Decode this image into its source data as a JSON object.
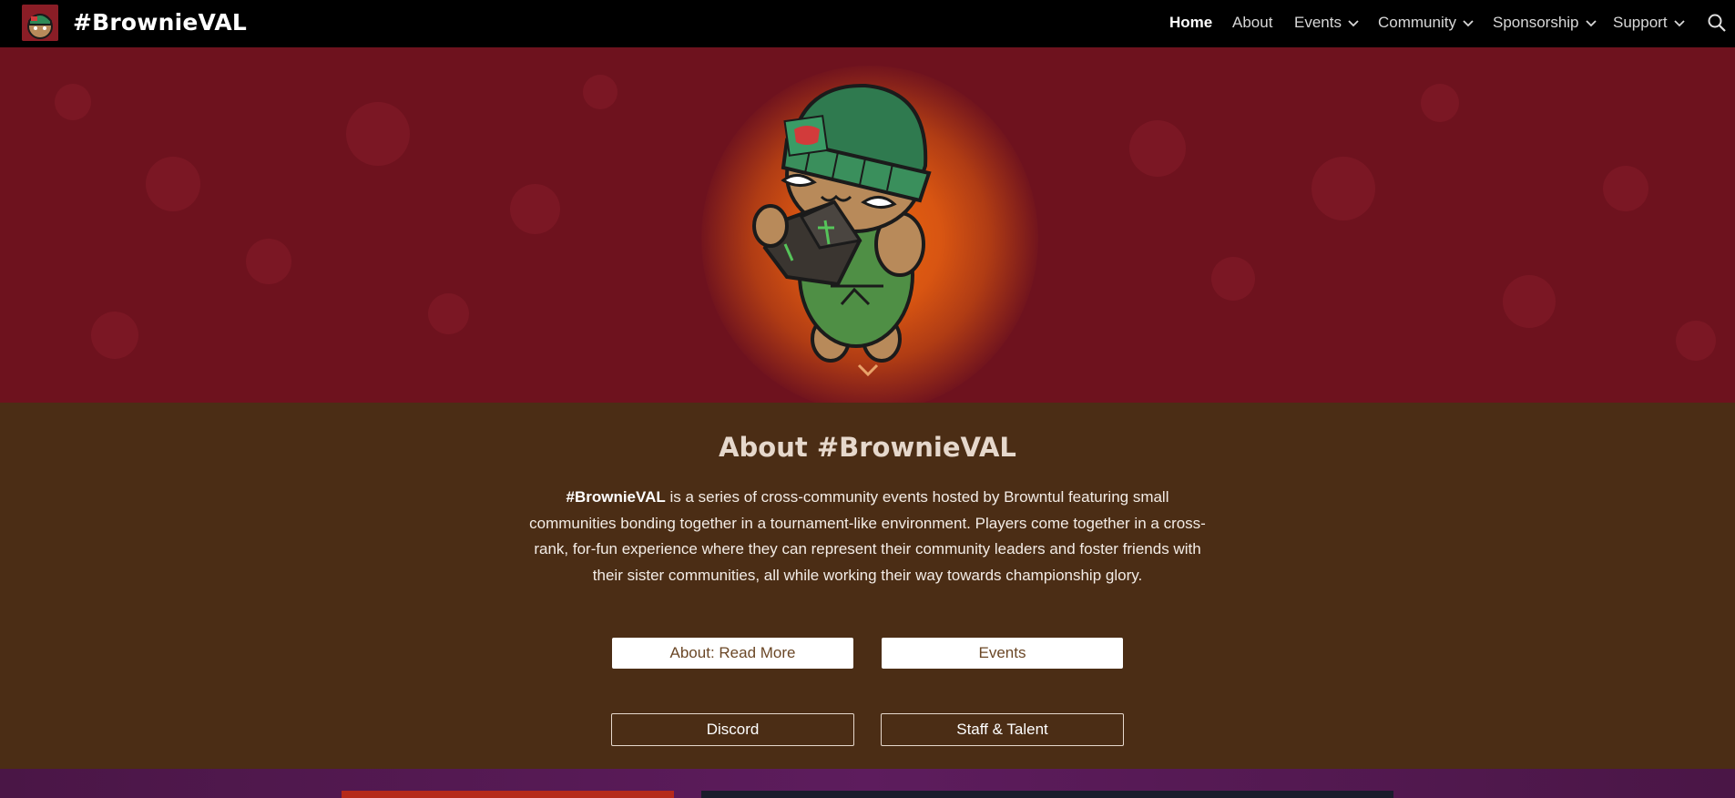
{
  "header": {
    "site_title": "#BrownieVAL",
    "nav": [
      {
        "label": "Home",
        "active": true,
        "has_dropdown": false
      },
      {
        "label": "About",
        "active": false,
        "has_dropdown": false
      },
      {
        "label": "Events",
        "active": false,
        "has_dropdown": true
      },
      {
        "label": "Community",
        "active": false,
        "has_dropdown": true
      },
      {
        "label": "Sponsorship",
        "active": false,
        "has_dropdown": true
      },
      {
        "label": "Support",
        "active": false,
        "has_dropdown": true
      }
    ],
    "search_icon": "search-icon"
  },
  "hero": {
    "mascot": "brownie-mascot-with-green-beanie",
    "scroll_icon": "chevron-down-icon"
  },
  "about": {
    "title": "About #BrownieVAL",
    "body_bold": "#BrownieVAL",
    "body_rest": " is a series of cross-community events hosted by Browntul featuring small communities bonding together in a tournament-like environment. Players come together in a cross-rank, for-fun experience where they can represent their community leaders and foster friends with their sister communities, all while working their way towards championship glory.",
    "buttons": {
      "read_more": "About: Read More",
      "events": "Events",
      "discord": "Discord",
      "staff": "Staff & Talent"
    }
  },
  "colors": {
    "nav_bg": "#000000",
    "hero_bg": "#6e121e",
    "hero_glow": "#e8650e",
    "about_bg": "#4b2d15",
    "button_text": "#6b4726",
    "bottom_bg": "#5d1c5d"
  }
}
